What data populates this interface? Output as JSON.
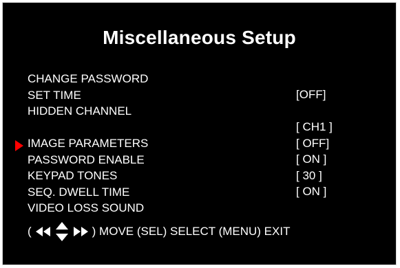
{
  "title": "Miscellaneous Setup",
  "menu": {
    "items": [
      {
        "label": "CHANGE PASSWORD"
      },
      {
        "label": "SET TIME"
      },
      {
        "label": "HIDDEN CHANNEL"
      },
      {
        "label": ""
      },
      {
        "label": "IMAGE PARAMETERS"
      },
      {
        "label": "PASSWORD ENABLE"
      },
      {
        "label": "KEYPAD TONES"
      },
      {
        "label": "SEQ. DWELL TIME"
      },
      {
        "label": "VIDEO LOSS SOUND"
      }
    ],
    "selected_index": 4
  },
  "values": [
    "[OFF]",
    "",
    "[ CH1 ]",
    "[ OFF]",
    "[ ON ]",
    "[ 30 ]",
    "[ ON ]"
  ],
  "help": {
    "open": "(",
    "text": ") MOVE (SEL) SELECT (MENU) EXIT"
  },
  "colors": {
    "background": "#000000",
    "text": "#ffffff",
    "cursor": "#ff0000"
  },
  "icons": {
    "cursor": "triangle-right-icon",
    "navigation": "direction-arrows-icon"
  }
}
